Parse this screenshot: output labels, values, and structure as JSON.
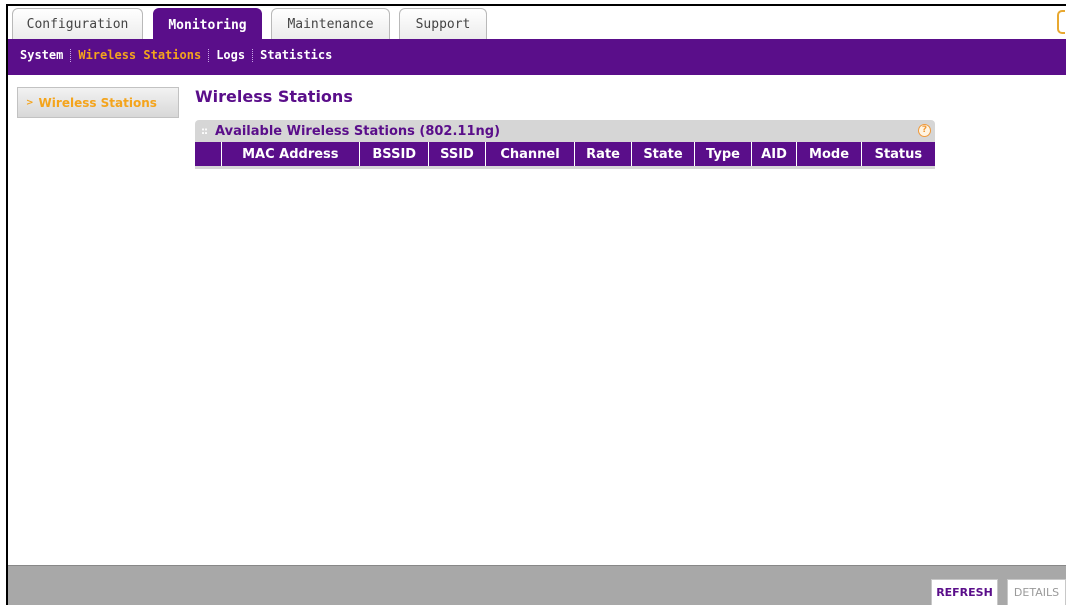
{
  "tabs": [
    {
      "label": "Configuration"
    },
    {
      "label": "Monitoring"
    },
    {
      "label": "Maintenance"
    },
    {
      "label": "Support"
    }
  ],
  "subnav": {
    "items": [
      {
        "label": "System"
      },
      {
        "label": "Wireless Stations"
      },
      {
        "label": "Logs"
      },
      {
        "label": "Statistics"
      }
    ]
  },
  "leftnav": {
    "item": "Wireless Stations"
  },
  "page": {
    "title": "Wireless Stations"
  },
  "panel": {
    "title": "Available Wireless Stations (802.11ng)",
    "help_icon": "?",
    "columns": [
      "",
      "MAC Address",
      "BSSID",
      "SSID",
      "Channel",
      "Rate",
      "State",
      "Type",
      "AID",
      "Mode",
      "Status"
    ]
  },
  "footer": {
    "refresh": "REFRESH",
    "details": "DETAILS"
  },
  "colors": {
    "brand": "#5a0e8a",
    "accent": "#f4a41c"
  }
}
